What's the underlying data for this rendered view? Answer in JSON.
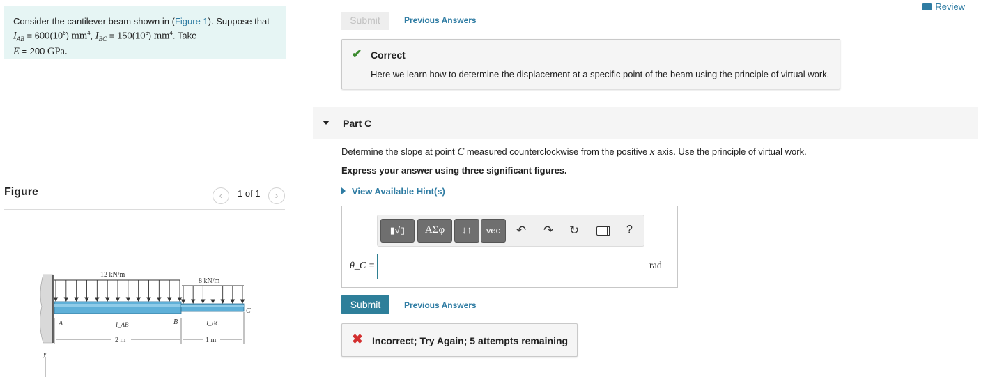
{
  "problem": {
    "intro": "Consider the cantilever beam shown in (",
    "figure_link": "Figure 1",
    "intro_end": "). Suppose that",
    "line2": "I_AB = 600(10^6) mm^4, I_BC = 150(10^6) mm^4. Take",
    "line3": "E = 200 GPa."
  },
  "figure": {
    "title": "Figure",
    "pager": "1 of 1",
    "prev_glyph": "‹",
    "next_glyph": "›",
    "labels": {
      "load_ab": "12 kN/m",
      "load_bc": "8 kN/m",
      "point_a": "A",
      "point_b": "B",
      "point_c": "C",
      "i_ab": "I_AB",
      "i_bc": "I_BC",
      "dim_ab": "2 m",
      "dim_bc": "1 m",
      "axis_y": "y"
    }
  },
  "header": {
    "review": "Review"
  },
  "part_b": {
    "submit_label": "Submit",
    "previous_answers": "Previous Answers",
    "feedback_title": "Correct",
    "feedback_text": "Here we learn how to determine the displacement at a specific point of the beam using the principle of virtual work."
  },
  "part_c": {
    "title": "Part C",
    "prompt_pre": "Determine the slope at point ",
    "prompt_point": "C",
    "prompt_mid": " measured counterclockwise from the positive ",
    "prompt_axis": "x",
    "prompt_post": " axis. Use the principle of virtual work.",
    "instruction": "Express your answer using three significant figures.",
    "hints": "View Available Hint(s)",
    "toolbar": {
      "templates": "▮√▯",
      "greek": "ΑΣφ",
      "arrows": "↓↑",
      "vec": "vec",
      "help": "?"
    },
    "variable": "θ_C =",
    "input_value": "",
    "unit": "rad",
    "submit_label": "Submit",
    "previous_answers": "Previous Answers",
    "feedback": "Incorrect; Try Again; 5 attempts remaining"
  },
  "colors": {
    "accent": "#2f7ca3",
    "correct": "#3b8a2e",
    "incorrect": "#d32f2f",
    "beam": "#5fb0d8"
  }
}
